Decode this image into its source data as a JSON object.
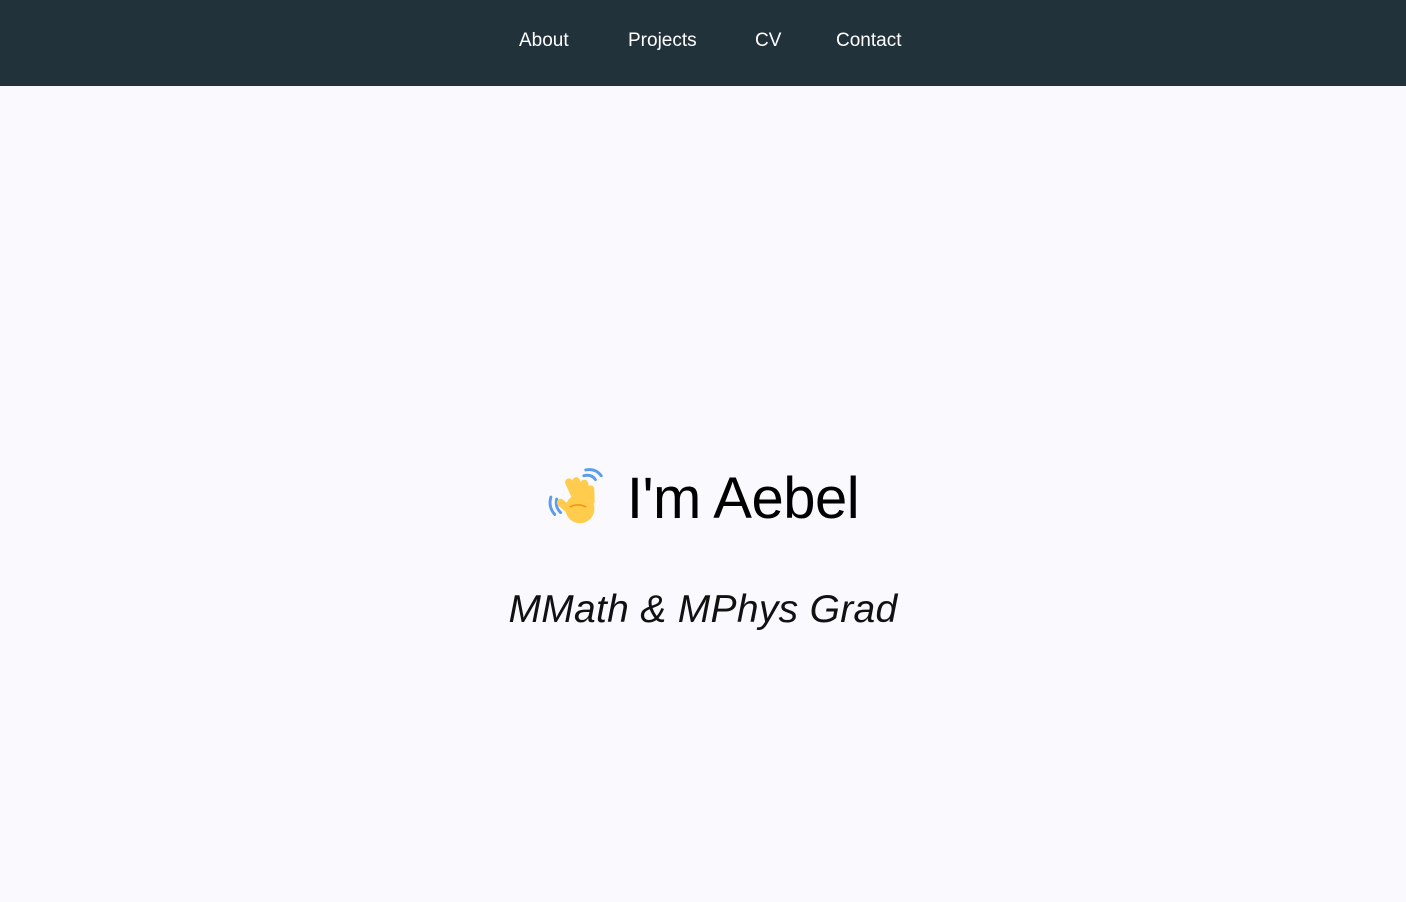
{
  "nav": {
    "items": [
      {
        "label": "About"
      },
      {
        "label": "Projects"
      },
      {
        "label": "CV"
      },
      {
        "label": "Contact"
      }
    ]
  },
  "hero": {
    "icon": "waving-hand-icon",
    "title": "I'm Aebel",
    "subtitle": "MMath & MPhys Grad"
  },
  "colors": {
    "nav_background": "#22323b",
    "page_background": "#f9f9fe",
    "nav_text": "#ffffff",
    "title_text": "#000000"
  }
}
